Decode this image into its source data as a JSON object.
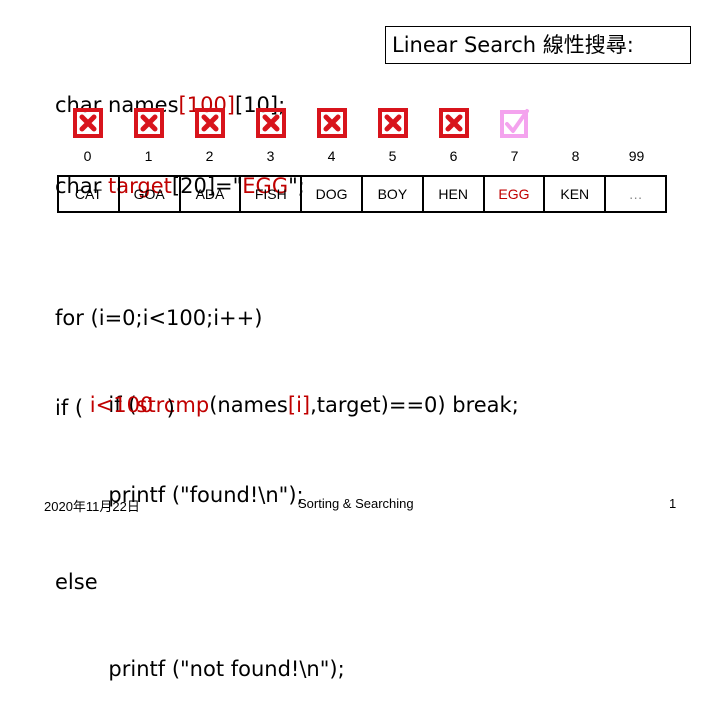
{
  "declarations": {
    "line1": {
      "prefix": "char names",
      "highlight": "[100]",
      "suffix": "[10];"
    },
    "line2": {
      "prefix": "char ",
      "highlight": "target",
      "middle": "[20]=\"",
      "highlight2": "EGG",
      "suffix": "\";"
    }
  },
  "title": "Linear Search 線性搜尋:",
  "marks": [
    {
      "type": "cross-icon",
      "index": 0
    },
    {
      "type": "cross-icon",
      "index": 1
    },
    {
      "type": "cross-icon",
      "index": 2
    },
    {
      "type": "cross-icon",
      "index": 3
    },
    {
      "type": "cross-icon",
      "index": 4
    },
    {
      "type": "cross-icon",
      "index": 5
    },
    {
      "type": "cross-icon",
      "index": 6
    },
    {
      "type": "check-icon",
      "index": 7
    }
  ],
  "colors": {
    "cross": "#d8141c",
    "check": "#f4a3ee",
    "highlight": "#c00000"
  },
  "indices": [
    "0",
    "1",
    "2",
    "3",
    "4",
    "5",
    "6",
    "7",
    "8",
    "99"
  ],
  "array_cells": [
    "CAT",
    "GOA",
    "ADA",
    "FISH",
    "DOG",
    "BOY",
    "HEN",
    "EGG",
    "KEN",
    "…"
  ],
  "found_index": 7,
  "code": {
    "for_line": "for (i=0;i<100;i++)",
    "if_prefix": "        if (",
    "if_func": "strcmp",
    "if_mid": "(names",
    "if_idx": "[i]",
    "if_suffix": ",target)==0) break;",
    "cond_prefix": "if ( ",
    "cond_expr": "i<100",
    "cond_suffix": "  )",
    "found_line": "        printf (\"found!\\n\");",
    "else_line": "else",
    "notfound_line": "        printf (\"not found!\\n\");"
  },
  "footer": {
    "date": "2020年11月22日",
    "title": "Sorting & Searching",
    "page": "1"
  }
}
